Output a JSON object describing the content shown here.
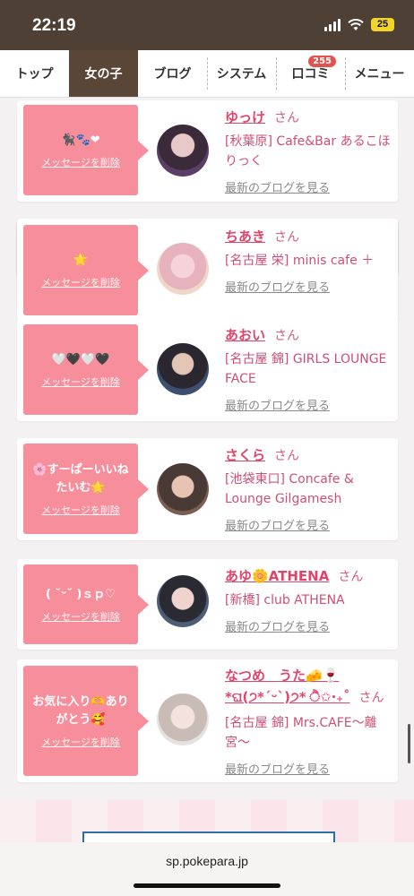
{
  "status_bar": {
    "time": "22:19",
    "battery": "25"
  },
  "nav": {
    "tabs": [
      {
        "label": "トップ",
        "active": false
      },
      {
        "label": "女の子",
        "active": true
      },
      {
        "label": "ブログ",
        "active": false
      },
      {
        "label": "システム",
        "active": false
      },
      {
        "label": "口コミ",
        "active": false,
        "badge": "255"
      },
      {
        "label": "メニュー",
        "active": false
      }
    ]
  },
  "favorites": [
    {
      "message": "🐈‍⬛🐾❤",
      "delete_label": "メッセージを削除",
      "name": "ゆっけ",
      "suffix": "さん",
      "shop": "[秋葉原] Cafe&Bar あるこほりっく",
      "blog_link": "最新のブログを見る"
    },
    {
      "message": "🌟",
      "delete_label": "メッセージを削除",
      "name": "ちあき",
      "suffix": "さん",
      "shop": "[名古屋 栄] minis cafe ＋",
      "blog_link": "最新のブログを見る"
    },
    {
      "message": "🤍🖤🤍🖤",
      "delete_label": "メッセージを削除",
      "name": "あおい",
      "suffix": "さん",
      "shop": "[名古屋 錦] GIRLS LOUNGE FACE",
      "blog_link": "最新のブログを見る"
    },
    {
      "message": "🌸すーぱーいいねたいむ🌟",
      "delete_label": "メッセージを削除",
      "name": "さくら",
      "suffix": "さん",
      "shop": "[池袋東口] Concafe & Lounge Gilgamesh",
      "blog_link": "最新のブログを見る"
    },
    {
      "message": "( ˘ᵕ˘ )ｓｐ♡",
      "delete_label": "メッセージを削除",
      "name": "あゆ🌼ATHENA",
      "suffix": "さん",
      "shop": "[新橋] club ATHENA",
      "blog_link": "最新のブログを見る"
    },
    {
      "message": "お気に入り🫶ありがとう🥰",
      "delete_label": "メッセージを削除",
      "name": "なつめ　うた🧀🍷*ଘ(੭*ˊᵕˋ)੭* ੈ✩‧₊˚",
      "suffix": "さん",
      "shop": "[名古屋 錦] Mrs.CAFE〜離宮〜",
      "blog_link": "最新のブログを見る"
    }
  ],
  "browser": {
    "url": "sp.pokepara.jp"
  }
}
